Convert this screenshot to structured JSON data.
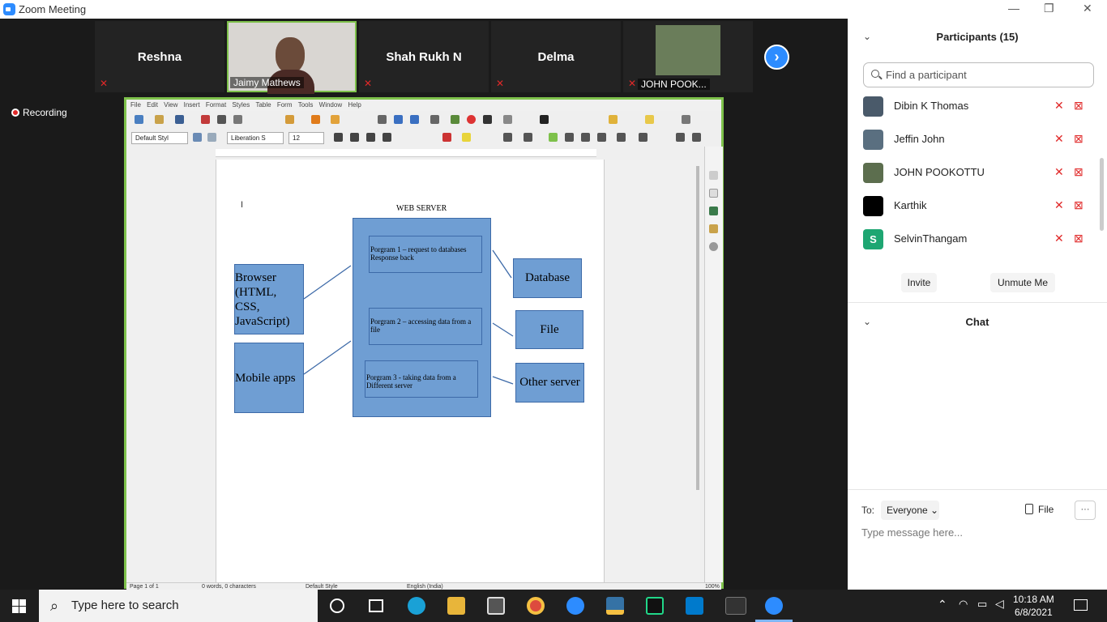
{
  "window": {
    "title": "Zoom Meeting",
    "minimize": "—",
    "restore": "❐",
    "close": "✕"
  },
  "gallery": {
    "tiles": [
      {
        "name": "Reshna"
      },
      {
        "name": "Jaimy Mathews"
      },
      {
        "name": "Shah Rukh N"
      },
      {
        "name": "Delma"
      },
      {
        "name": "JOHN POOK..."
      }
    ],
    "next_icon": "›"
  },
  "recording": {
    "label": "Recording"
  },
  "writer": {
    "menu": [
      "File",
      "Edit",
      "View",
      "Insert",
      "Format",
      "Styles",
      "Table",
      "Form",
      "Tools",
      "Window",
      "Help"
    ],
    "style_box": "Default Styl",
    "font_box": "Liberation S",
    "size_box": "12",
    "status": {
      "page": "Page 1 of 1",
      "words": "0 words, 0 characters",
      "style": "Default Style",
      "lang": "English (India)",
      "zoom": "100%"
    },
    "diagram": {
      "title": "WEB SERVER",
      "browser": "Browser (HTML, CSS, JavaScript)",
      "mobile": "Mobile apps",
      "prog1": "Porgram 1 – request to databases Response back",
      "prog2": "Porgram 2 – accessing data from a file",
      "prog3": "Porgram 3 -  taking data from a Different server",
      "database": "Database",
      "file": "File",
      "other": "Other server"
    }
  },
  "participants": {
    "header": "Participants (15)",
    "search_placeholder": "Find a participant",
    "list": [
      {
        "name": "Dibin K Thomas",
        "avatar_color": "#4a5a6a"
      },
      {
        "name": "Jeffin John",
        "avatar_color": "#5a6f80"
      },
      {
        "name": "JOHN POOKOTTU",
        "avatar_color": "#5c6e4e"
      },
      {
        "name": "Karthik",
        "avatar_color": "#000000"
      },
      {
        "name": "SelvinThangam",
        "avatar_color": "#1ea672",
        "initial": "S"
      }
    ],
    "invite": "Invite",
    "unmute": "Unmute Me"
  },
  "chat": {
    "header": "Chat",
    "to_label": "To:",
    "to_value": "Everyone",
    "file_label": "File",
    "more": "···",
    "input_placeholder": "Type message here..."
  },
  "taskbar": {
    "search_placeholder": "Type here to search",
    "time": "10:18 AM",
    "date": "6/8/2021"
  },
  "colors": {
    "zoom_blue": "#2d8cff",
    "mute_red": "#e02828",
    "share_border": "#7ec14b",
    "box_fill": "#6f9ed3"
  }
}
